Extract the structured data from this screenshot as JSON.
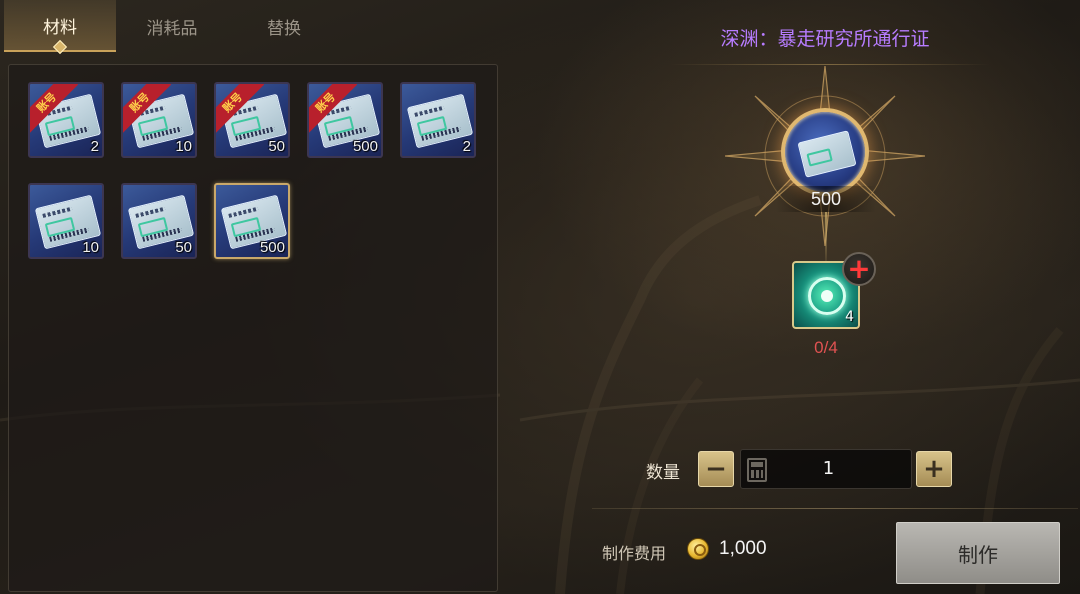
{
  "tabs": [
    {
      "label": "材料",
      "active": true
    },
    {
      "label": "消耗品",
      "active": false
    },
    {
      "label": "替换",
      "active": false
    }
  ],
  "inventory": {
    "items": [
      {
        "ribbon": "账号",
        "count": "2",
        "selected": false
      },
      {
        "ribbon": "账号",
        "count": "10",
        "selected": false
      },
      {
        "ribbon": "账号",
        "count": "50",
        "selected": false
      },
      {
        "ribbon": "账号",
        "count": "500",
        "selected": false
      },
      {
        "ribbon": "",
        "count": "2",
        "selected": false
      },
      {
        "ribbon": "",
        "count": "10",
        "selected": false
      },
      {
        "ribbon": "",
        "count": "50",
        "selected": false
      },
      {
        "ribbon": "",
        "count": "500",
        "selected": true
      }
    ]
  },
  "recipe": {
    "title": "深渊：暴走研究所通行证",
    "product_count": "500",
    "material_count": "4",
    "material_progress": "0/4"
  },
  "quantity": {
    "label": "数量",
    "minus": "−",
    "plus": "+",
    "value": "1"
  },
  "cost": {
    "label": "制作费用",
    "value": "1,000"
  },
  "craft_button": "制作",
  "colors": {
    "title": "#b77cff",
    "requirement_insufficient": "#e05252",
    "accent_gold": "#d8c38a"
  }
}
